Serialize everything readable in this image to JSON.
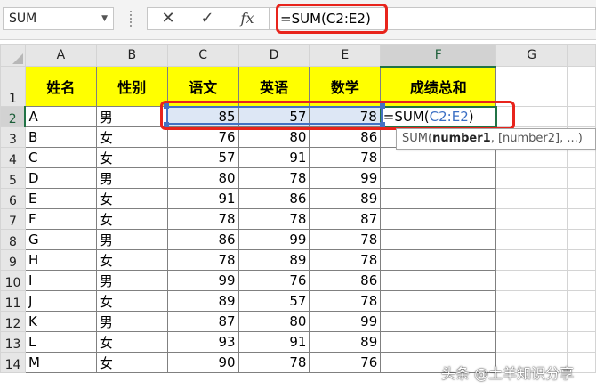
{
  "name_box": {
    "value": "SUM"
  },
  "formula_bar": {
    "cancel_glyph": "✕",
    "enter_glyph": "✓",
    "fx_label": "fx",
    "formula": "=SUM(C2:E2)"
  },
  "columns": [
    "A",
    "B",
    "C",
    "D",
    "E",
    "F",
    "G"
  ],
  "rows": [
    "1",
    "2",
    "3",
    "4",
    "5",
    "6",
    "7",
    "8",
    "9",
    "10",
    "11",
    "12",
    "13",
    "14"
  ],
  "table": {
    "headers": [
      "姓名",
      "性别",
      "语文",
      "英语",
      "数学",
      "成绩总和"
    ],
    "rows": [
      [
        "A",
        "男",
        "85",
        "57",
        "78"
      ],
      [
        "B",
        "女",
        "76",
        "80",
        "86"
      ],
      [
        "C",
        "女",
        "57",
        "91",
        "78"
      ],
      [
        "D",
        "男",
        "80",
        "78",
        "99"
      ],
      [
        "E",
        "女",
        "91",
        "86",
        "89"
      ],
      [
        "F",
        "女",
        "78",
        "78",
        "87"
      ],
      [
        "G",
        "男",
        "86",
        "99",
        "78"
      ],
      [
        "H",
        "女",
        "78",
        "89",
        "78"
      ],
      [
        "I",
        "男",
        "99",
        "76",
        "86"
      ],
      [
        "J",
        "女",
        "89",
        "57",
        "78"
      ],
      [
        "K",
        "男",
        "87",
        "80",
        "99"
      ],
      [
        "L",
        "女",
        "93",
        "91",
        "89"
      ],
      [
        "M",
        "女",
        "90",
        "78",
        "76"
      ]
    ]
  },
  "active_cell": {
    "prefix": "=SUM(",
    "range": "C2:E2",
    "suffix": ")"
  },
  "tooltip": {
    "func": "SUM(",
    "arg1": "number1",
    "rest": ", [number2], ...)"
  },
  "watermark": "头条 @土羊知识分享",
  "colors": {
    "header_fill": "#ffff00",
    "highlight_red": "#e8241c",
    "reference_blue": "#4472c4",
    "active_green": "#217346"
  }
}
